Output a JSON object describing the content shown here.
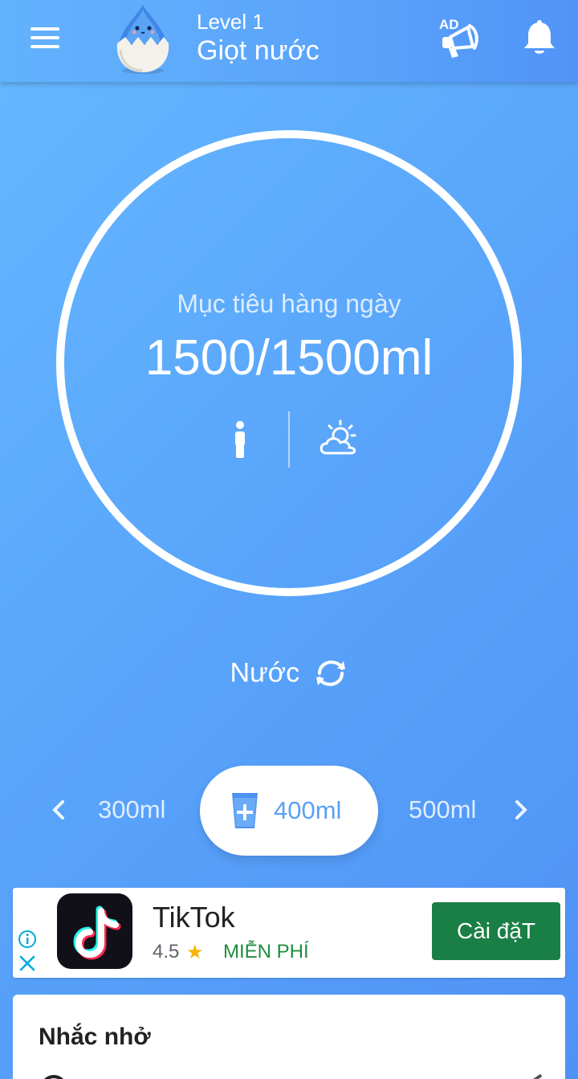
{
  "header": {
    "level": "Level 1",
    "rank_name": "Giọt nước",
    "icons": [
      "menu-icon",
      "water-drop-mascot",
      "ad-megaphone-icon",
      "bell-icon"
    ],
    "ad_badge": "AD"
  },
  "goal": {
    "label": "Mục tiêu hàng ngày",
    "value": "1500/1500ml",
    "progress": 1.0,
    "icons": [
      "person-icon",
      "sun-cloud-icon"
    ]
  },
  "drink": {
    "label": "Nước",
    "swap_icon": "refresh-icon"
  },
  "volume_selector": {
    "prev": "300ml",
    "selected": "400ml",
    "next": "500ml",
    "icons": [
      "chevron-left-icon",
      "cup-plus-icon",
      "chevron-right-icon"
    ]
  },
  "ad": {
    "app_name": "TikTok",
    "rating": "4.5",
    "price": "MIỄN PHÍ",
    "install_label": "Cài đặT",
    "install_color": "#1a7f45"
  },
  "reminder": {
    "title": "Nhắc nhở"
  },
  "colors": {
    "background_start": "#66b8ff",
    "background_end": "#4f92f5",
    "accent": "#5aa0f5"
  }
}
